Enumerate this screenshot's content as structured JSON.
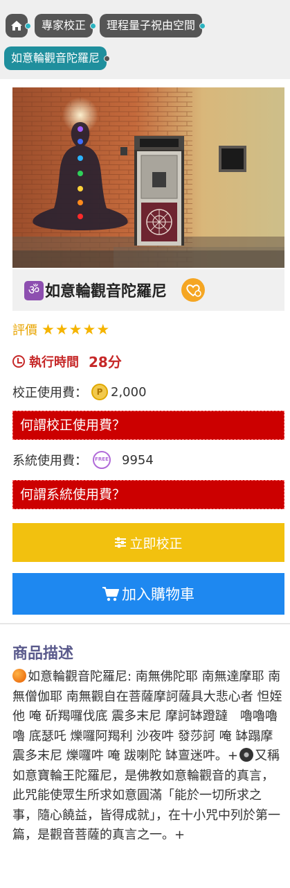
{
  "breadcrumb": {
    "home_icon": "home-icon",
    "items": [
      "專家校正",
      "理程量子祝由空間",
      "如意輪觀音陀羅尼"
    ]
  },
  "product": {
    "image_alt": "meditation figure with chakras on brick wall beside door",
    "title": "如意輪觀音陀羅尼",
    "rating_label": "評價",
    "rating": 5,
    "rating_max": 5,
    "exec_label": "執行時間",
    "exec_value": "28分",
    "calib_fee_label": "校正使用費：",
    "calib_fee_value": "2,000",
    "calib_fee_link": "何謂校正使用費？",
    "system_fee_label": "系統使用費：",
    "system_fee_value": "9954",
    "system_fee_link": "何謂系統使用費？",
    "calibrate_button": "立即校正",
    "cart_button": "加入購物車"
  },
  "description": {
    "heading": "商品描述",
    "text_part1": "如意輪觀音陀羅尼: 南無佛陀耶 南無達摩耶 南無僧伽耶 南無觀自在菩薩摩訶薩具大悲心者 怛姪他 唵 斫羯囉伐底 震多末尼 摩訶缽蹬躂　嚕嚕嚕嚕 底瑟吒 爍囉阿羯利 沙夜吽 發莎訶 唵 缽蹋摩 震多末尼 爍囉吽 唵 跋喇陀 缽亶迷吽。+",
    "text_part2": "又稱如意寶輪王陀羅尼，是佛教如意輪觀音的真言，此咒能使眾生所求如意圓滿「能於一切所求之事，隨心饒益，皆得成就」，在十小咒中列於第一篇，是觀音菩薩的真言之一。+"
  },
  "colors": {
    "accent_red": "#cc0000",
    "button_yellow": "#f2c10f",
    "button_blue": "#1e88f0",
    "teal": "#1f8f9d"
  }
}
